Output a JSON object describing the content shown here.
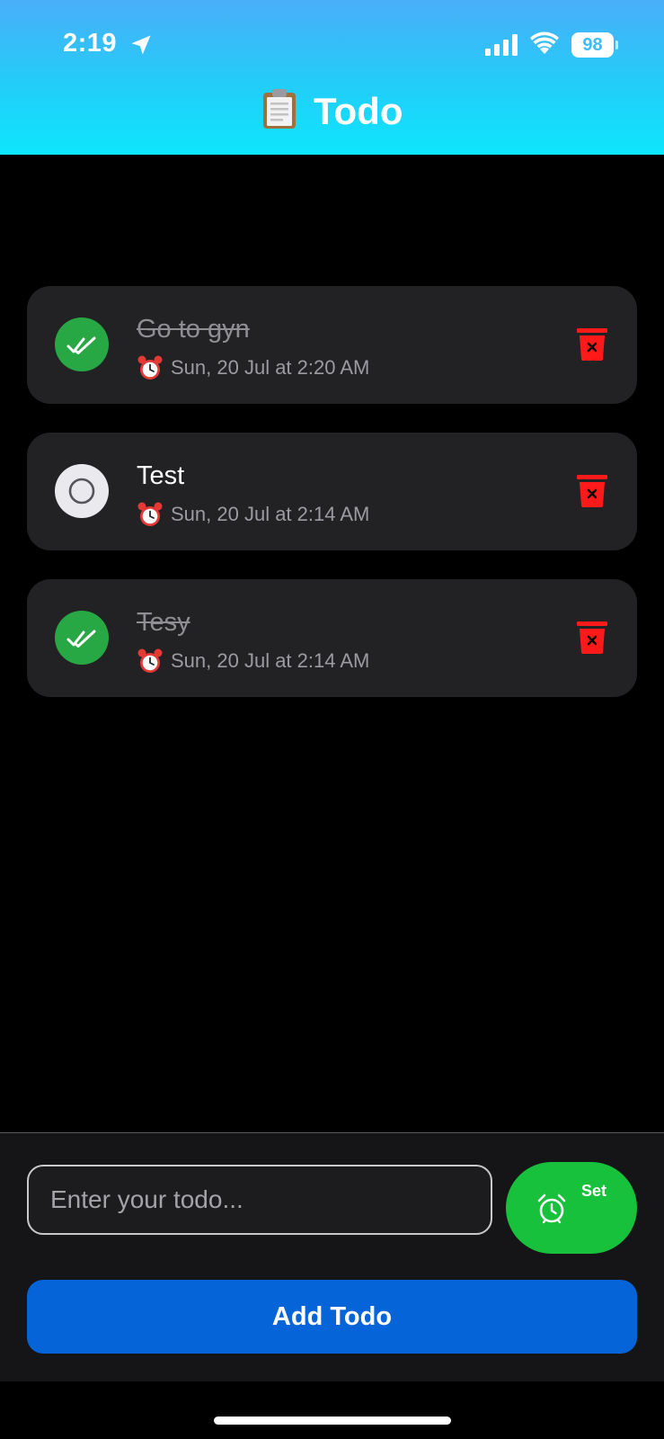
{
  "status_bar": {
    "time": "2:19",
    "battery": "98"
  },
  "header": {
    "title": "Todo",
    "icon": "clipboard-icon"
  },
  "todos": [
    {
      "text": "Go to gyn",
      "done": true,
      "reminder": "Sun, 20 Jul at 2:20 AM"
    },
    {
      "text": "Test",
      "done": false,
      "reminder": "Sun, 20 Jul at 2:14 AM"
    },
    {
      "text": "Tesy",
      "done": true,
      "reminder": "Sun, 20 Jul at 2:14 AM"
    }
  ],
  "composer": {
    "placeholder": "Enter your todo...",
    "set_label": "Set",
    "add_label": "Add Todo"
  },
  "colors": {
    "done_green": "#27a844",
    "delete_red": "#ff1a1a",
    "set_green": "#17c13c",
    "add_blue": "#0565d8"
  }
}
